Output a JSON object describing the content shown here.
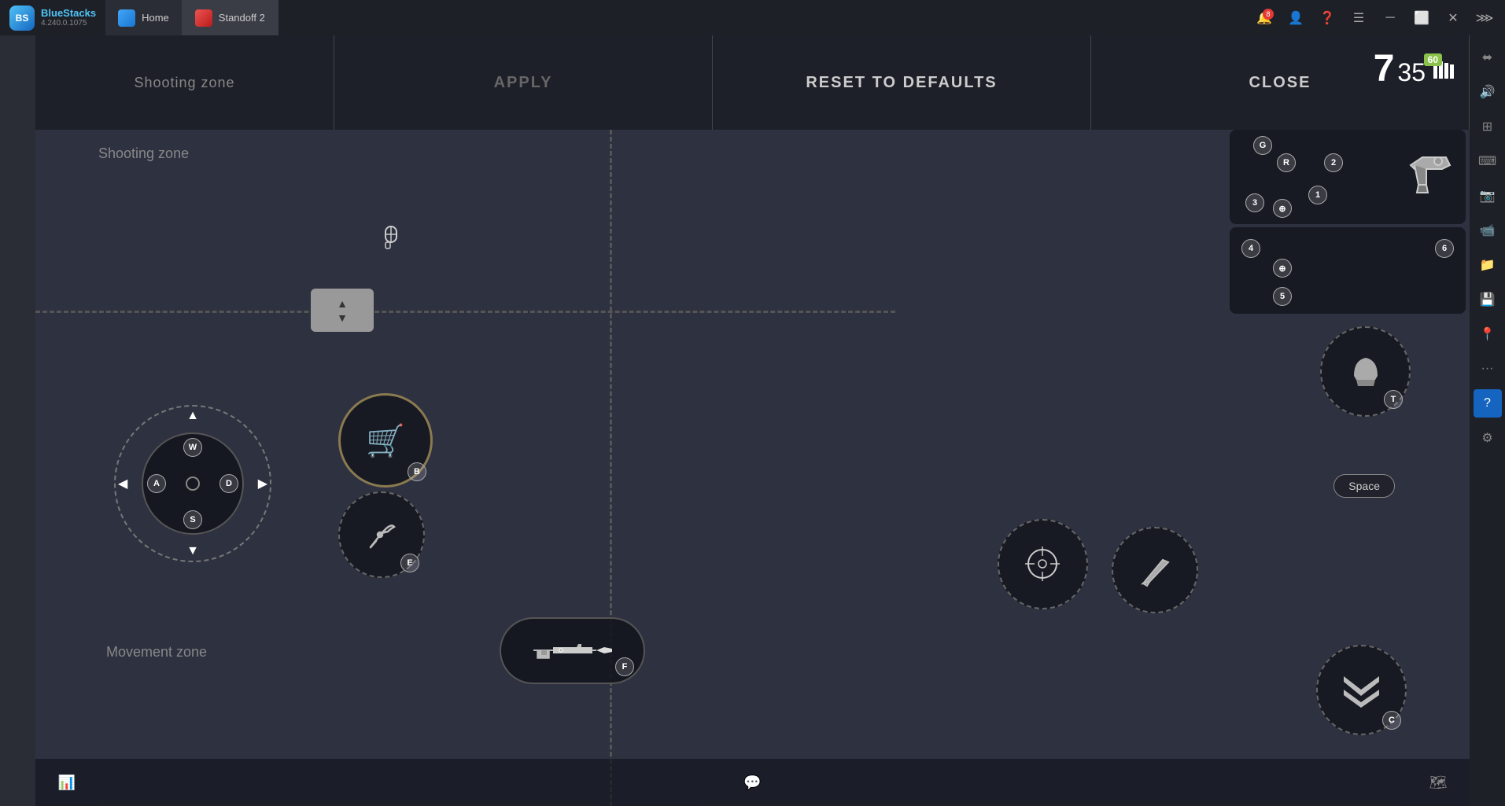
{
  "titlebar": {
    "app_name": "BlueStacks",
    "version": "4.240.0.1075",
    "home_tab": "Home",
    "game_tab": "Standoff 2"
  },
  "toolbar": {
    "shooting_zone": "Shooting zone",
    "apply_label": "APPLY",
    "reset_label": "RESET TO DEFAULTS",
    "close_label": "CLOSE"
  },
  "hud": {
    "ammo_current": "7",
    "ammo_total": "35",
    "fps": "60"
  },
  "controls": {
    "joystick_keys": [
      "W",
      "A",
      "S",
      "D"
    ],
    "cart_key": "B",
    "tool_key": "E",
    "weapon_key": "F",
    "aim_key": "",
    "knife_key": "",
    "space_key": "Space",
    "chevron_key": "C",
    "helmet_key": "T",
    "num_keys": [
      "1",
      "2",
      "3",
      "4",
      "5",
      "6"
    ],
    "crosshair_key": "",
    "reload_key": "R",
    "grenade_key": "G"
  },
  "zones": {
    "shooting": "Shooting zone",
    "movement": "Movement zone"
  },
  "sidebar_icons": [
    "📊",
    "💬",
    "📷",
    "📤",
    "📁",
    "📹",
    "📍",
    "···",
    "❓",
    "⚙"
  ],
  "bottom_icons": [
    "📊",
    "💬",
    "🗺"
  ]
}
